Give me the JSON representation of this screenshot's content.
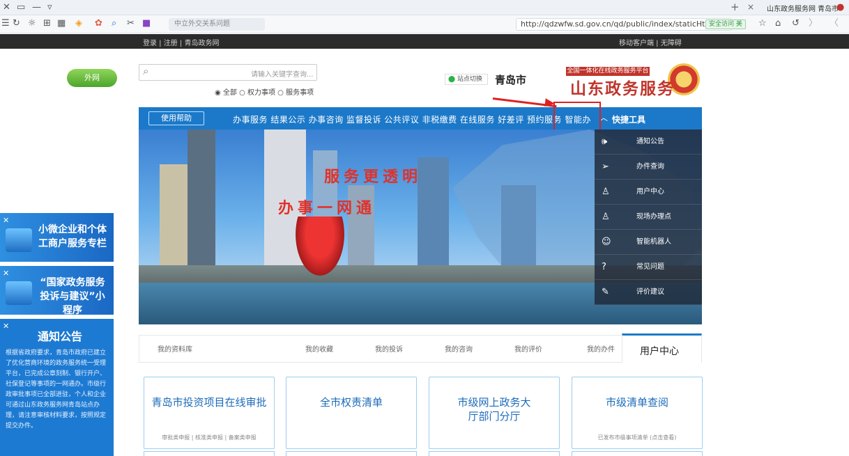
{
  "browser": {
    "tab_title": "山东政务服务网 青岛市",
    "url": "http://qdzwfw.sd.gov.cn/qd/public/index/staticHtml/index_qd",
    "secure_badge": "安全访问 美",
    "search_placeholder": "中立外交关系问题"
  },
  "topstrip": {
    "left_links": "登录 | 注册 | 青岛政务网",
    "right_links": "移动客户端 | 无障碍"
  },
  "header": {
    "logo_subtitle": "全国一体化在线政务服务平台",
    "logo_title": "山东政务服务",
    "city": "青岛市",
    "city_switch": "站点切换",
    "search_placeholder": "请输入关键字查询...",
    "radios": "◉ 全部 ○ 权力事项 ○ 服务事项",
    "green_button": "外网"
  },
  "nav": {
    "quick_tools": "快捷工具",
    "help_button": "使用帮助",
    "items": "办事服务 结果公示 办事咨询 监督投诉 公共评议 非税缴费 在线服务 好差评 预约服务 智能办"
  },
  "banner": {
    "slogan1": "服务更透明",
    "slogan2": "办事一网通"
  },
  "quick_panel": {
    "items": [
      {
        "icon": "speaker-icon",
        "glyph": "🕪",
        "label": "通知公告"
      },
      {
        "icon": "send-icon",
        "glyph": "➢",
        "label": "办件查询"
      },
      {
        "icon": "user-icon",
        "glyph": "♙",
        "label": "用户中心"
      },
      {
        "icon": "person-icon",
        "glyph": "♙",
        "label": "现场办理点"
      },
      {
        "icon": "robot-icon",
        "glyph": "☺",
        "label": "智能机器人"
      },
      {
        "icon": "question-icon",
        "glyph": "?",
        "label": "常见问题"
      },
      {
        "icon": "edit-icon",
        "glyph": "✎",
        "label": "评价建议"
      }
    ]
  },
  "floats": {
    "f1": "小微企业和个体工商户服务专栏",
    "f2": "“国家政务服务投诉与建议”小程序",
    "notice_title": "通知公告",
    "notice_body": "根据省政府要求，青岛市政府已建立了优化营商环境的政务服务统一受理平台，已完成公章刻制、银行开户、社保登记等事项的一网通办。市级行政审批事项已全部进驻，个人和企业可通过山东政务服务网青岛站点办理，请注意审核材料要求，按照规定提交办件。"
  },
  "user_center": {
    "active_tab": "用户中心",
    "tabs": [
      "我的办件",
      "我的评价",
      "我的咨询",
      "我的投诉",
      "我的收藏",
      "我的资料库"
    ]
  },
  "cards": [
    {
      "title": "市级清单查阅",
      "sub": "已发布市级事项清单 (点击查看)"
    },
    {
      "title": "市级网上政务大厅部门分厅",
      "sub": ""
    },
    {
      "title": "全市权责清单",
      "sub": ""
    },
    {
      "title": "青岛市投资项目在线审批",
      "sub": "审批类申报 | 核准类申报 | 备案类申报"
    }
  ],
  "colors": {
    "nav_blue": "#1c79c9",
    "brand_red": "#c0342b",
    "highlight_red": "#e02020"
  }
}
